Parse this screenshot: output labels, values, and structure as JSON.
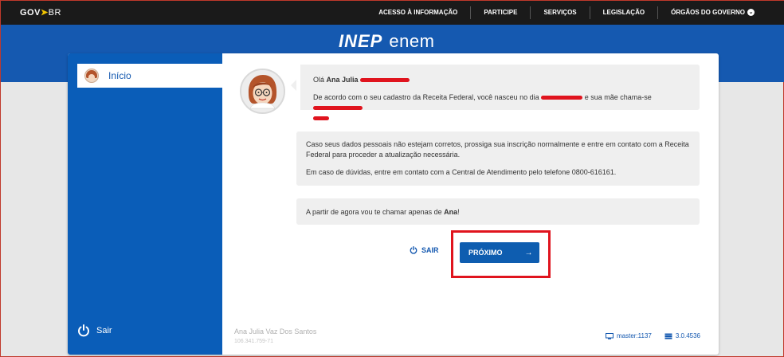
{
  "govbar": {
    "logo_gov": "GOV",
    "logo_br": "BR",
    "nav": [
      {
        "label": "ACESSO À INFORMAÇÃO"
      },
      {
        "label": "PARTICIPE"
      },
      {
        "label": "SERVIÇOS"
      },
      {
        "label": "LEGISLAÇÃO"
      },
      {
        "label": "ÓRGÃOS DO GOVERNO"
      }
    ]
  },
  "brand": {
    "inep": "INEP",
    "enem": "enem"
  },
  "sidebar": {
    "items": [
      {
        "label": "Início"
      }
    ],
    "logout_label": "Sair"
  },
  "messages": {
    "greeting_prefix": "Olá ",
    "user_first_name": "Ana Julia",
    "birth_text_prefix": "De acordo com o seu cadastro da Receita Federal, você nasceu no dia",
    "birth_text_mid": "e sua mãe chama-se",
    "info_line1": "Caso seus dados pessoais não estejam corretos, prossiga sua inscrição normalmente e entre em contato com a Receita Federal para proceder a atualização necessária.",
    "info_line2": "Em caso de dúvidas, entre em contato com a Central de Atendimento pelo telefone 0800-616161.",
    "call_prefix": "A partir de agora vou te chamar apenas de ",
    "call_name": "Ana",
    "call_suffix": "!"
  },
  "actions": {
    "exit_label": "SAIR",
    "next_label": "PRÓXIMO",
    "next_arrow": "→"
  },
  "footer": {
    "user_name": "Ana Julia Vaz Dos Santos",
    "user_cpf": "106.341.759-71",
    "server_label": "master:1137",
    "version_label": "3.0.4536"
  },
  "colors": {
    "primary_blue": "#1559b0",
    "sidebar_blue": "#0a5db8",
    "gov_bar": "#1a1a1a",
    "highlight_red": "#e0141e"
  },
  "icons": {
    "power": "power-icon",
    "arrow": "arrow-right-icon",
    "monitor": "monitor-icon",
    "server": "server-icon",
    "chevron": "chevron-down-icon"
  }
}
